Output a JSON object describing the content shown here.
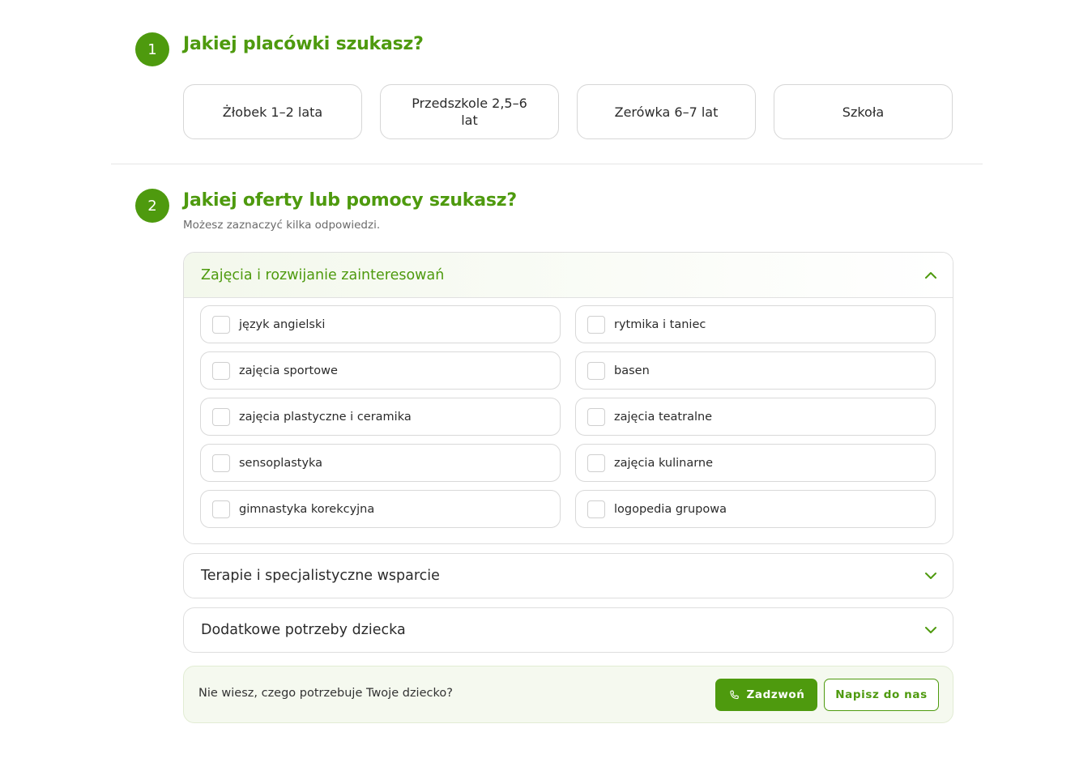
{
  "step1": {
    "number": "1",
    "title": "Jakiej placówki szukasz?",
    "options": [
      "Żłobek 1–2 lata",
      "Przedszkole 2,5–6 lat",
      "Zerówka 6–7 lat",
      "Szkoła"
    ]
  },
  "step2": {
    "number": "2",
    "title": "Jakiej oferty lub pomocy szukasz?",
    "subtitle": "Możesz zaznaczyć kilka odpowiedzi.",
    "sections": [
      {
        "title": "Zajęcia i rozwijanie zainteresowań",
        "expanded": true,
        "chevron_icon": "chevron-up-icon",
        "items": [
          "język angielski",
          "rytmika i taniec",
          "zajęcia sportowe",
          "basen",
          "zajęcia plastyczne i ceramika",
          "zajęcia teatralne",
          "sensoplastyka",
          "zajęcia kulinarne",
          "gimnastyka korekcyjna",
          "logopedia grupowa"
        ],
        "checked": [
          false,
          false,
          false,
          false,
          false,
          false,
          false,
          false,
          false,
          false
        ]
      },
      {
        "title": "Terapie i specjalistyczne wsparcie",
        "expanded": false,
        "chevron_icon": "chevron-down-icon"
      },
      {
        "title": "Dodatkowe potrzeby dziecka",
        "expanded": false,
        "chevron_icon": "chevron-down-icon"
      }
    ]
  },
  "help": {
    "text": "Nie wiesz, czego potrzebuje Twoje dziecko?",
    "call_label": "Zadzwoń",
    "call_icon": "phone-icon",
    "write_label": "Napisz do nas"
  },
  "colors": {
    "accent": "#4e9a0e",
    "border": "#d9d9d9",
    "help_bg": "#f5f9ef"
  }
}
